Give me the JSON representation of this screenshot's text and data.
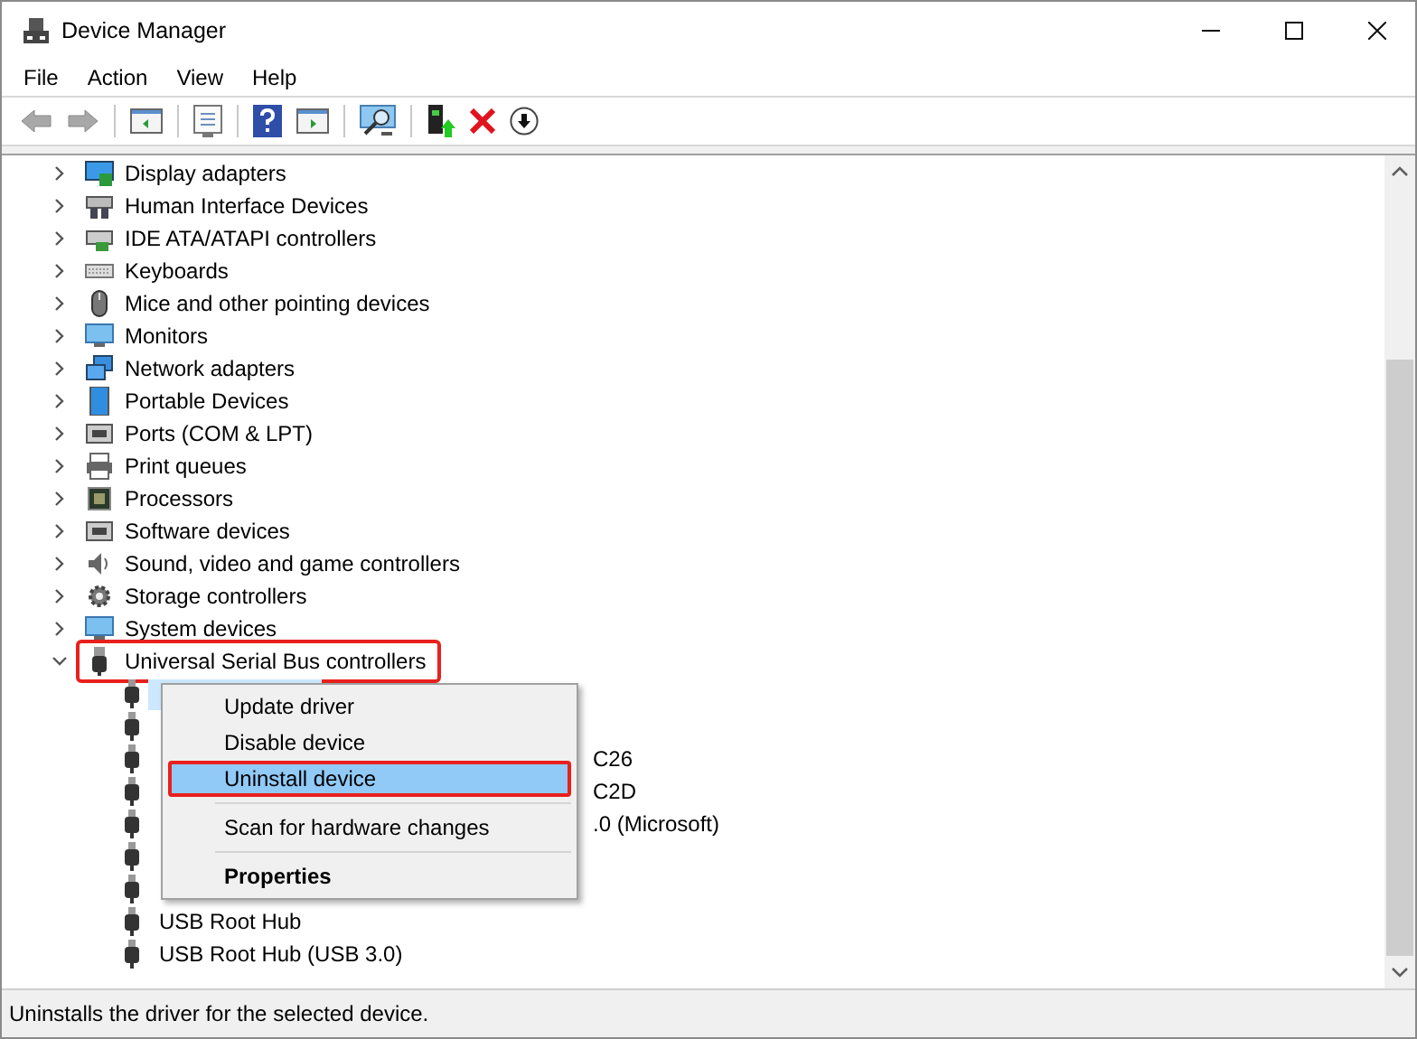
{
  "window": {
    "title": "Device Manager"
  },
  "menu": [
    "File",
    "Action",
    "View",
    "Help"
  ],
  "toolbar": [
    {
      "kind": "back",
      "disabled": true
    },
    {
      "kind": "forward",
      "disabled": true
    },
    {
      "kind": "separator"
    },
    {
      "kind": "panel",
      "disabled": false
    },
    {
      "kind": "separator"
    },
    {
      "kind": "properties",
      "disabled": false
    },
    {
      "kind": "separator"
    },
    {
      "kind": "help",
      "disabled": false
    },
    {
      "kind": "panel-right",
      "disabled": false
    },
    {
      "kind": "separator"
    },
    {
      "kind": "scan",
      "disabled": false
    },
    {
      "kind": "separator"
    },
    {
      "kind": "update",
      "disabled": false
    },
    {
      "kind": "delete",
      "disabled": false
    },
    {
      "kind": "download",
      "disabled": false
    }
  ],
  "tree": [
    {
      "label": "Display adapters",
      "expanded": false,
      "annotated": false
    },
    {
      "label": "Human Interface Devices",
      "expanded": false,
      "annotated": false
    },
    {
      "label": "IDE ATA/ATAPI controllers",
      "expanded": false,
      "annotated": false
    },
    {
      "label": "Keyboards",
      "expanded": false,
      "annotated": false
    },
    {
      "label": "Mice and other pointing devices",
      "expanded": false,
      "annotated": false
    },
    {
      "label": "Monitors",
      "expanded": false,
      "annotated": false
    },
    {
      "label": "Network adapters",
      "expanded": false,
      "annotated": false
    },
    {
      "label": "Portable Devices",
      "expanded": false,
      "annotated": false
    },
    {
      "label": "Ports (COM & LPT)",
      "expanded": false,
      "annotated": false
    },
    {
      "label": "Print queues",
      "expanded": false,
      "annotated": false
    },
    {
      "label": "Processors",
      "expanded": false,
      "annotated": false
    },
    {
      "label": "Software devices",
      "expanded": false,
      "annotated": false
    },
    {
      "label": "Sound, video and game controllers",
      "expanded": false,
      "annotated": false
    },
    {
      "label": "Storage controllers",
      "expanded": false,
      "annotated": false
    },
    {
      "label": "System devices",
      "expanded": false,
      "annotated": false
    },
    {
      "label": "Universal Serial Bus controllers",
      "expanded": true,
      "annotated": true,
      "children": [
        {
          "selected": true
        },
        {
          "selected": false
        },
        {
          "tail": "C26",
          "selected": false
        },
        {
          "tail": "C2D",
          "selected": false
        },
        {
          "tail": ".0 (Microsoft)",
          "selected": false
        },
        {
          "selected": false
        },
        {
          "selected": false
        },
        {
          "label": "USB Root Hub",
          "selected": false
        },
        {
          "label": "USB Root Hub (USB 3.0)",
          "selected": false
        }
      ]
    }
  ],
  "context_menu": [
    {
      "kind": "item",
      "label": "Update driver",
      "selected": false,
      "annotated": false,
      "default": false
    },
    {
      "kind": "item",
      "label": "Disable device",
      "selected": false,
      "annotated": false,
      "default": false
    },
    {
      "kind": "item",
      "label": "Uninstall device",
      "selected": true,
      "annotated": true,
      "default": false
    },
    {
      "kind": "separator"
    },
    {
      "kind": "item",
      "label": "Scan for hardware changes",
      "selected": false,
      "annotated": false,
      "default": false
    },
    {
      "kind": "separator"
    },
    {
      "kind": "item",
      "label": "Properties",
      "selected": false,
      "annotated": false,
      "default": true
    }
  ],
  "status_bar": "Uninstalls the driver for the selected device."
}
